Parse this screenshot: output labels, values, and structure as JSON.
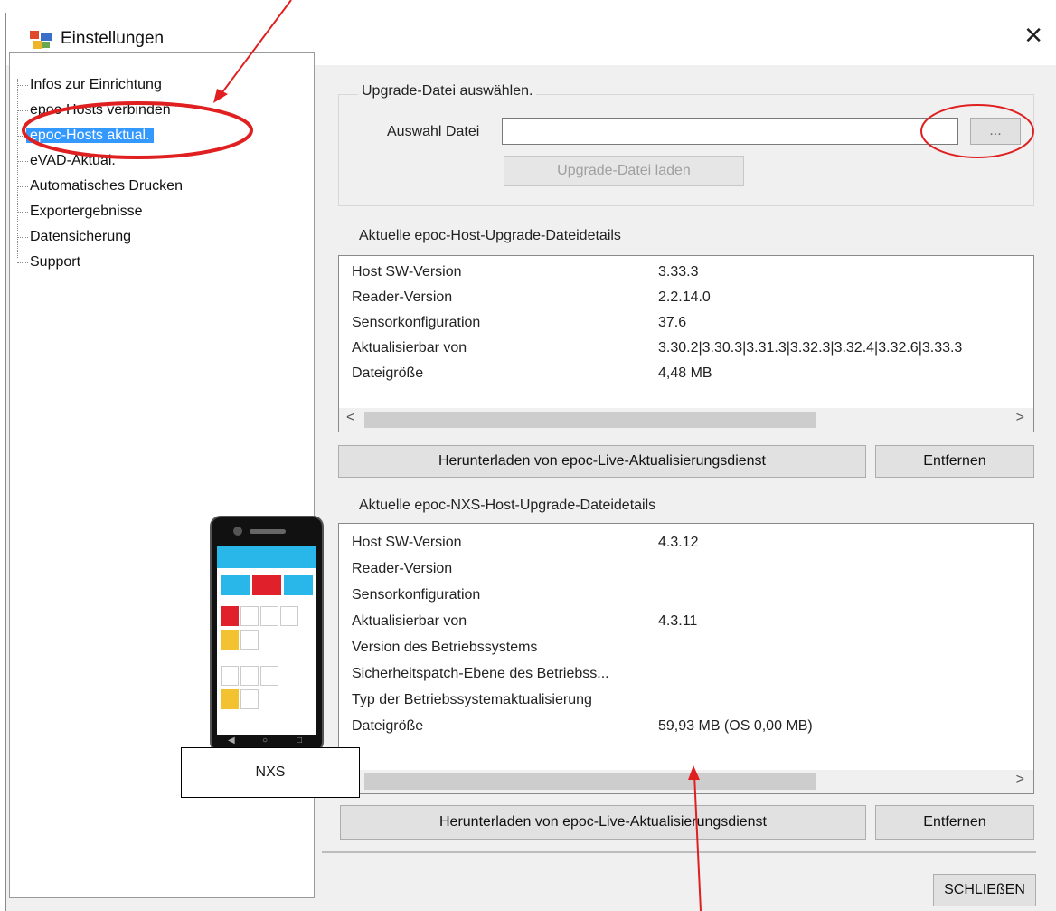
{
  "window": {
    "title": "Einstellungen",
    "close_glyph": "✕",
    "icon": "settings-app-icon"
  },
  "sidebar": {
    "items": [
      {
        "label": "Infos zur Einrichtung"
      },
      {
        "label": "epoc-Hosts verbinden"
      },
      {
        "label": "epoc-Hosts aktual.",
        "selected": true
      },
      {
        "label": "eVAD-Aktual."
      },
      {
        "label": "Automatisches Drucken"
      },
      {
        "label": "Exportergebnisse"
      },
      {
        "label": "Datensicherung"
      },
      {
        "label": "Support"
      }
    ]
  },
  "upgrade_file": {
    "group_title": "Upgrade-Datei auswählen.",
    "file_label": "Auswahl Datei",
    "file_value": "",
    "browse_label": "...",
    "load_label": "Upgrade-Datei laden"
  },
  "host_details": {
    "title": "Aktuelle epoc-Host-Upgrade-Dateidetails",
    "rows": [
      {
        "label": "Host SW-Version",
        "value": "3.33.3"
      },
      {
        "label": "Reader-Version",
        "value": "2.2.14.0"
      },
      {
        "label": "Sensorkonfiguration",
        "value": "37.6"
      },
      {
        "label": "Aktualisierbar von",
        "value": "3.30.2|3.30.3|3.31.3|3.32.3|3.32.4|3.32.6|3.33.3"
      },
      {
        "label": "Dateigröße",
        "value": "4,48 MB"
      }
    ],
    "download_label": "Herunterladen von epoc-Live-Aktualisierungsdienst",
    "remove_label": "Entfernen"
  },
  "nxs_details": {
    "title": "Aktuelle epoc-NXS-Host-Upgrade-Dateidetails",
    "rows": [
      {
        "label": "Host SW-Version",
        "value": "4.3.12"
      },
      {
        "label": "Reader-Version",
        "value": ""
      },
      {
        "label": "Sensorkonfiguration",
        "value": ""
      },
      {
        "label": "Aktualisierbar von",
        "value": "4.3.11"
      },
      {
        "label": "Version des Betriebssystems",
        "value": ""
      },
      {
        "label": "Sicherheitspatch-Ebene des Betriebss...",
        "value": ""
      },
      {
        "label": "Typ der Betriebssystemaktualisierung",
        "value": ""
      },
      {
        "label": "Dateigröße",
        "value": "59,93 MB (OS 0,00 MB)"
      }
    ],
    "download_label": "Herunterladen von epoc-Live-Aktualisierungsdienst",
    "remove_label": "Entfernen"
  },
  "close_button_label": "SCHLIEßEN",
  "annotation": {
    "device_label": "NXS",
    "color": "#e02020"
  },
  "colors": {
    "selection": "#3399ff",
    "window_bg": "#f0f0f0",
    "button_bg": "#e1e1e1"
  }
}
